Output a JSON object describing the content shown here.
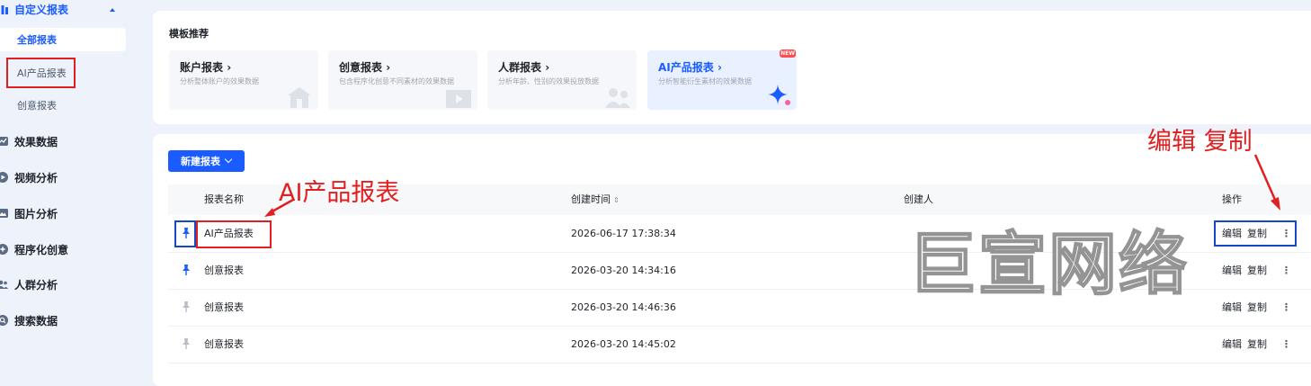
{
  "sidebar": {
    "custom_report": "自定义报表",
    "sub_items": [
      "全部报表",
      "AI产品报表",
      "创意报表"
    ],
    "items": [
      "效果数据",
      "视频分析",
      "图片分析",
      "程序化创意",
      "人群分析",
      "搜索数据"
    ]
  },
  "templates": {
    "title": "模板推荐",
    "new_badge": "NEW",
    "cards": [
      {
        "title": "账户报表",
        "desc": "分析整体账户的效果数据"
      },
      {
        "title": "创意报表",
        "desc": "包含程序化创意不同素材的效果数据"
      },
      {
        "title": "人群报表",
        "desc": "分析年龄、性别的效果投放数据"
      },
      {
        "title": "AI产品报表",
        "desc": "分析智能衍生素材的效果数据"
      }
    ]
  },
  "list": {
    "new_button": "新建报表",
    "columns": {
      "name": "报表名称",
      "created_time": "创建时间",
      "creator": "创建人",
      "ops": "操作"
    },
    "rows": [
      {
        "name": "AI产品报表",
        "time": "2026-06-17 17:38:34",
        "pinned": true
      },
      {
        "name": "创意报表",
        "time": "2026-03-20 14:34:16",
        "pinned": true
      },
      {
        "name": "创意报表",
        "time": "2026-03-20 14:46:36",
        "pinned": false
      },
      {
        "name": "创意报表",
        "time": "2026-03-20 14:45:02",
        "pinned": false
      }
    ],
    "edit": "编辑",
    "copy": "复制",
    "more": "⋮"
  },
  "annotations": {
    "report_label": "AI产品报表",
    "ops_label": "编辑 复制",
    "watermark": "巨宣网络"
  },
  "colors": {
    "accent": "#1a5cff",
    "annotation_red": "#e02020",
    "annotation_blue": "#1747c9"
  }
}
